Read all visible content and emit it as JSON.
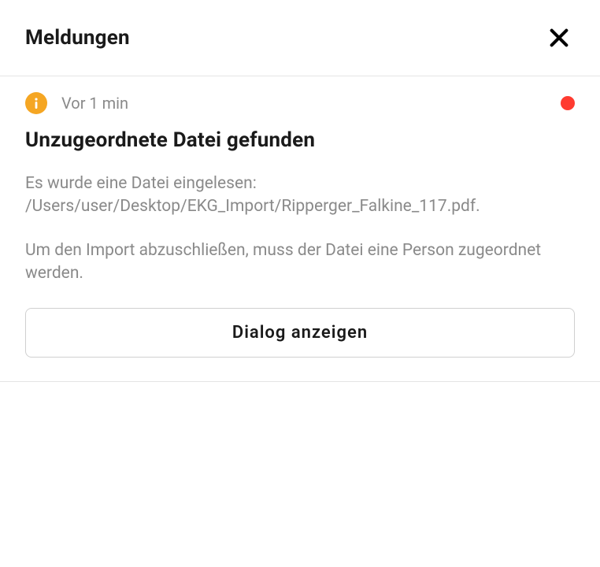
{
  "header": {
    "title": "Meldungen"
  },
  "notification": {
    "timestamp": "Vor 1 min",
    "title": "Unzugeordnete Datei gefunden",
    "body_line1": "Es wurde eine Datei eingelesen:",
    "body_line2": "/Users/user/Desktop/EKG_Import/Ripperger_Falkine_117.pdf.",
    "body_para2": "Um den Import abzuschließen, muss der Datei eine Person zugeordnet werden.",
    "action_label": "Dialog anzeigen",
    "status_color": "#ff3b30",
    "info_color": "#f5a623"
  }
}
